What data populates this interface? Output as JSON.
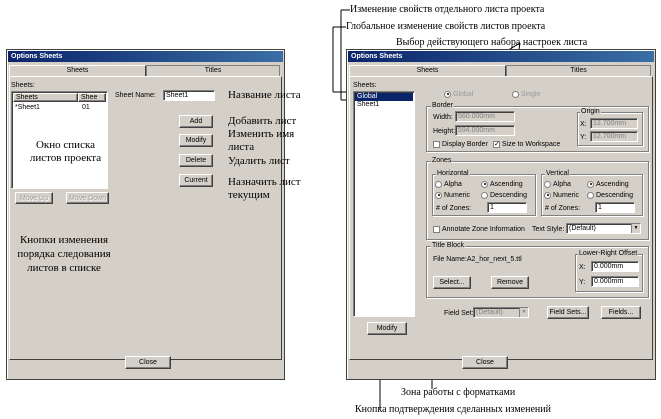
{
  "left_window": {
    "title": "Options Sheets",
    "tabs": [
      "Sheets",
      "Titles"
    ],
    "sheets_label": "Sheets:",
    "list_headers": [
      "Sheets",
      "Shee"
    ],
    "list_row": {
      "name": "*Sheet1",
      "num": "01"
    },
    "sheet_name_label": "Sheet Name:",
    "sheet_name_value": "Sheet1",
    "buttons": {
      "add": "Add",
      "modify": "Modify",
      "delete": "Delete",
      "current": "Current",
      "move_up": "Move Up",
      "move_down": "Move Down",
      "close": "Close"
    }
  },
  "right_window": {
    "title": "Options Sheets",
    "tabs": [
      "Sheets",
      "Titles"
    ],
    "sheets_label": "Sheets:",
    "list_items": [
      "Global",
      "Sheet1"
    ],
    "scope": {
      "global": "Global",
      "single": "Single"
    },
    "border": {
      "label": "Border",
      "width_label": "Width:",
      "width_value": "560.000mm",
      "height_label": "Height:",
      "height_value": "594.000mm",
      "display_border": "Display Border",
      "size_to_workspace": "Size to Workspace",
      "size_to_workspace_mark": "✓",
      "origin_label": "Origin",
      "x_label": "X:",
      "x_value": "12.700mm",
      "y_label": "Y:",
      "y_value": "12.700mm"
    },
    "zones": {
      "label": "Zones",
      "horizontal": {
        "label": "Horizontal",
        "alpha": "Alpha",
        "numeric": "Numeric",
        "ascending": "Ascending",
        "descending": "Descending",
        "num_zones_label": "# of Zones:",
        "num_zones_value": "1"
      },
      "vertical": {
        "label": "Vertical",
        "alpha": "Alpha",
        "numeric": "Numeric",
        "ascending": "Ascending",
        "descending": "Descending",
        "num_zones_label": "# of Zones:",
        "num_zones_value": "1"
      },
      "annotate": "Annotate Zone Information",
      "text_style_label": "Text Style:",
      "text_style_value": "(Default)"
    },
    "title_block": {
      "label": "Title Block",
      "file_name": "File Name:A2_hor_next_5.ttl",
      "select": "Select...",
      "remove": "Remove",
      "offset_label": "Lower-Right Offset",
      "x_label": "X:",
      "x_value": "0.000mm",
      "y_label": "Y:",
      "y_value": "0.000mm"
    },
    "field_set_label": "Field Set:",
    "field_set_value": "(Default)",
    "field_sets_button": "Field Sets...",
    "fields_button": "Fields...",
    "modify_button": "Modify",
    "close_button": "Close"
  },
  "annotations": {
    "list_window": "Окно списка листов проекта",
    "sheet_name": "Название листа",
    "add": "Добавить лист",
    "rename": "Изменить имя листа",
    "delete": "Удалить лист",
    "current": "Назначить лист текущим",
    "reorder": "Кнопки изменения порядка следования листов в списке",
    "top1": "Изменение свойств отдельного листа проекта",
    "top2": "Глобальное изменение свойств листов проекта",
    "top3": "Выбор действующего набора настроек листа",
    "bottom1": "Зона работы с форматками",
    "bottom2": "Кнопка подтверждения сделанных изменений"
  }
}
